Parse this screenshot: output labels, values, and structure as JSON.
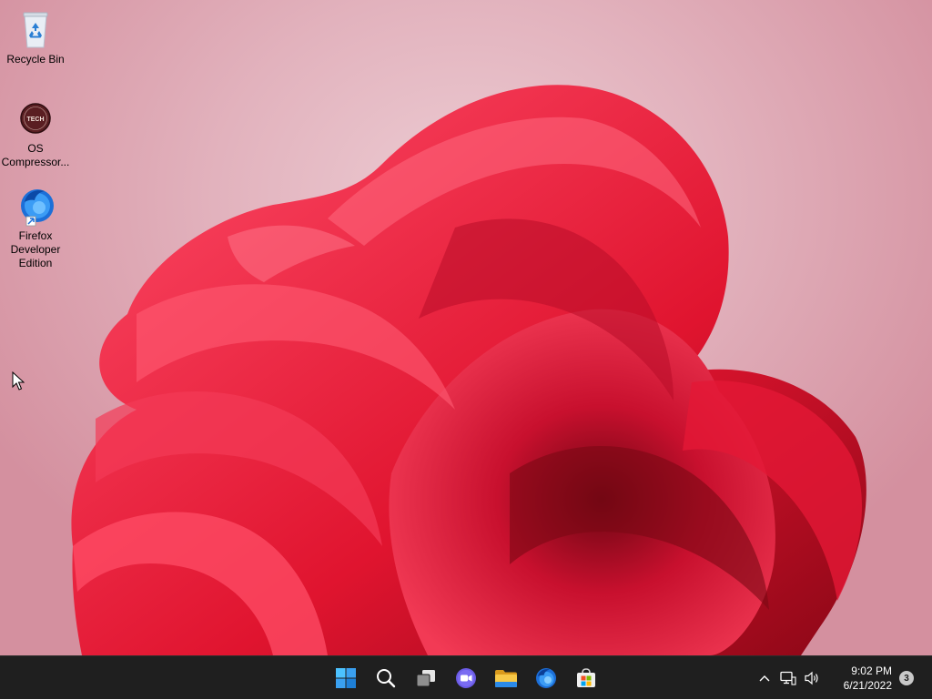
{
  "desktop": {
    "icons": [
      {
        "label": "Recycle Bin",
        "icon": "recycle-bin-icon"
      },
      {
        "label": "OS Compressor...",
        "icon": "os-compressor-icon"
      },
      {
        "label": "Firefox Developer Edition",
        "icon": "firefox-developer-icon"
      }
    ],
    "os_compressor_logo_text": "TECH"
  },
  "taskbar": {
    "apps": [
      {
        "name": "Start",
        "icon": "windows-start-icon"
      },
      {
        "name": "Search",
        "icon": "search-icon"
      },
      {
        "name": "Task View",
        "icon": "task-view-icon"
      },
      {
        "name": "Chat",
        "icon": "chat-icon"
      },
      {
        "name": "File Explorer",
        "icon": "file-explorer-icon"
      },
      {
        "name": "Firefox Developer Edition",
        "icon": "firefox-icon"
      },
      {
        "name": "Microsoft Store",
        "icon": "store-icon"
      }
    ],
    "tray": {
      "time": "9:02 PM",
      "date": "6/21/2022",
      "notification_count": "3"
    }
  },
  "colors": {
    "taskbar_bg": "#1f1f1f",
    "wallpaper_bg": "#e2b2bd",
    "bloom_red": "#e8193a",
    "start_blue": "#3aa0f0"
  }
}
